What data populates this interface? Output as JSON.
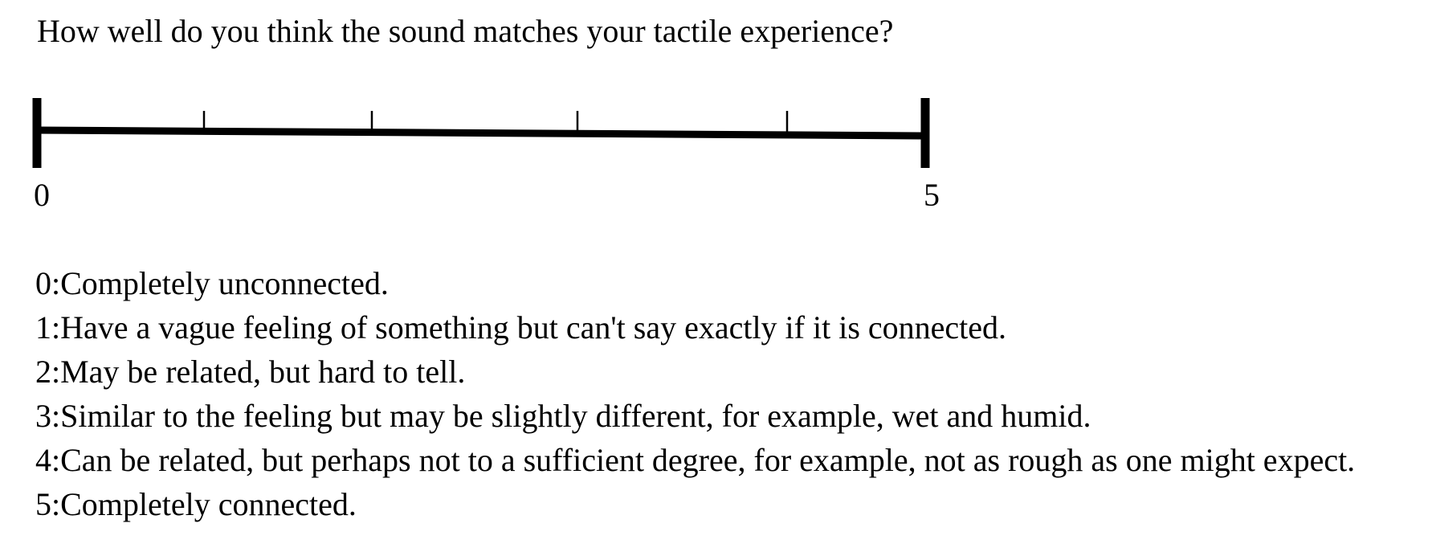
{
  "question": "How well do you think the sound matches your tactile experience?",
  "scale": {
    "min_label": "0",
    "max_label": "5",
    "min": 0,
    "max": 5,
    "color": "#000000"
  },
  "legend": [
    "0:Completely unconnected.",
    "1:Have a vague feeling of something but can't say exactly if it is connected.",
    "2:May be related, but hard to tell.",
    "3:Similar to the feeling but may be slightly different, for example, wet and humid.",
    "4:Can be related, but perhaps not to a sufficient degree, for example, not as rough as one might expect.",
    "5:Completely connected."
  ]
}
